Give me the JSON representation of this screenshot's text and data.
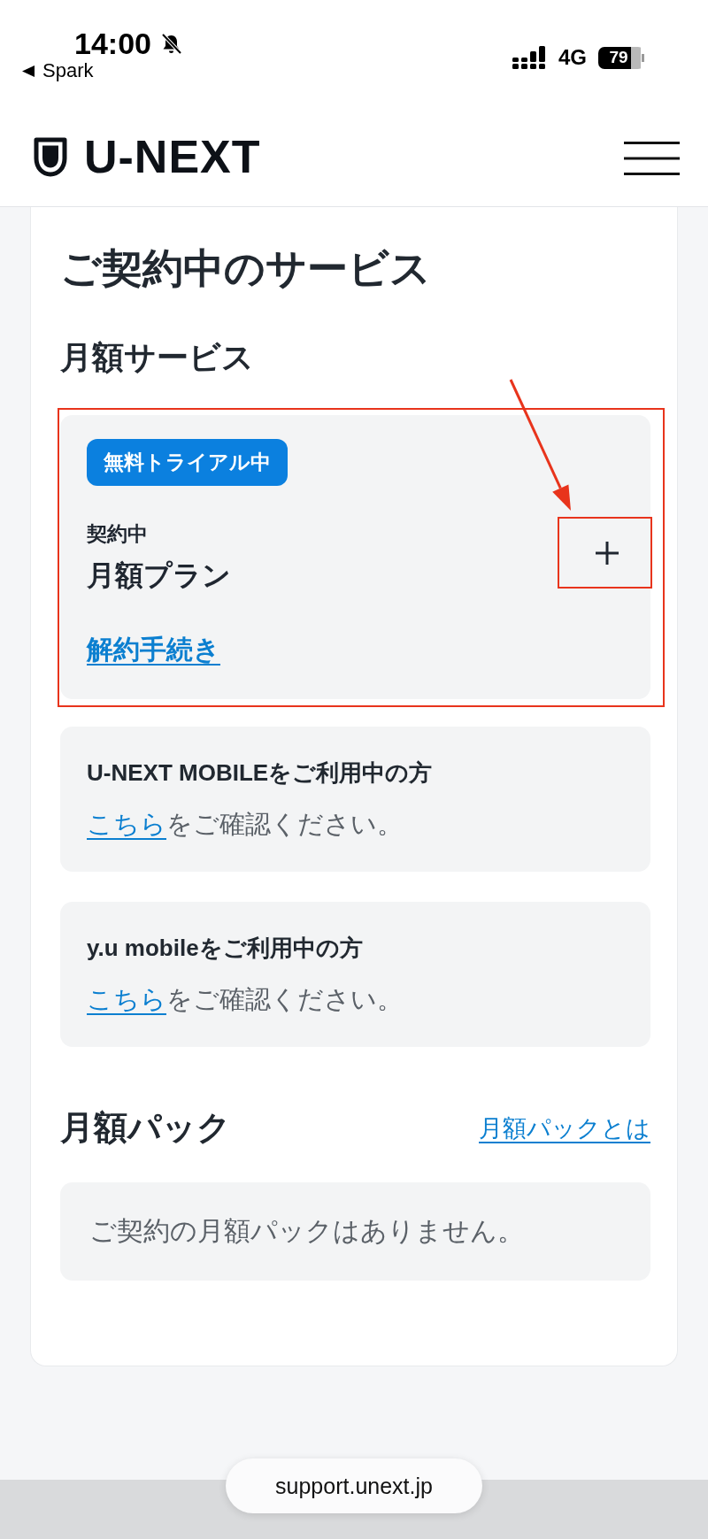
{
  "status_bar": {
    "time": "14:00",
    "back_app": "Spark",
    "network": "4G",
    "battery": "79"
  },
  "header": {
    "logo": "U-NEXT"
  },
  "title": "ご契約中のサービス",
  "monthly_services": {
    "heading": "月額サービス",
    "plan": {
      "highlighted": true,
      "badge": "無料トライアル中",
      "status": "契約中",
      "name": "月額プラン",
      "cancel_link": "解約手続き",
      "toggle": {
        "expanded": false,
        "highlighted": true,
        "pointed_at": true
      }
    },
    "notices": [
      {
        "title": "U-NEXT MOBILEをご利用中の方",
        "link": "こちら",
        "text": "をご確認ください。"
      },
      {
        "title": "y.u mobileをご利用中の方",
        "link": "こちら",
        "text": "をご確認ください。"
      }
    ]
  },
  "monthly_packs": {
    "heading": "月額パック",
    "info_link": "月額パックとは",
    "empty_message": "ご契約の月額パックはありません。"
  },
  "browser": {
    "url": "support.unext.jp"
  }
}
